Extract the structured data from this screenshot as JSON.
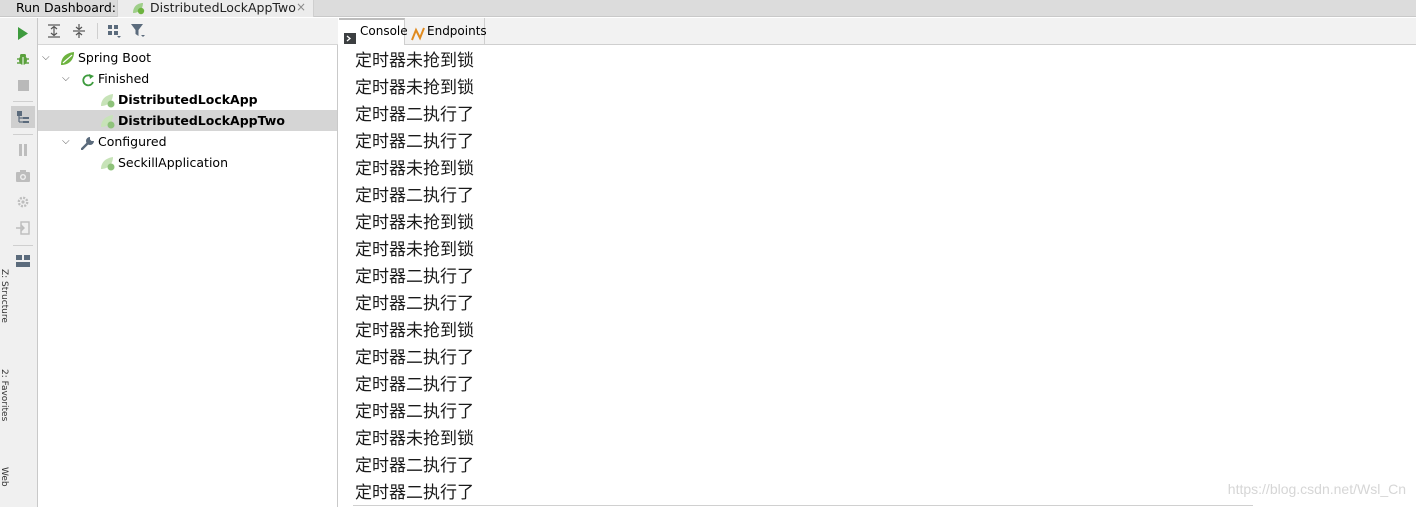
{
  "title_bar": {
    "label": "Run Dashboard:",
    "tab": {
      "name": "DistributedLockAppTwo",
      "close": "×"
    }
  },
  "toolbar": {
    "icons": [
      "run-icon",
      "debug-icon",
      "stop-icon",
      "group-by-icon",
      "pause-icon",
      "screenshot-icon",
      "settings-gear-icon",
      "sign-in-icon",
      "layout-icon"
    ]
  },
  "side_strip": {
    "structure": "Z: Structure",
    "favorites": "2: Favorites",
    "web": "Web"
  },
  "tree": {
    "root": "Spring Boot",
    "groups": [
      {
        "label": "Finished",
        "items": [
          "DistributedLockApp",
          "DistributedLockAppTwo"
        ]
      },
      {
        "label": "Configured",
        "items": [
          "SeckillApplication"
        ]
      }
    ]
  },
  "console": {
    "tabs": [
      "Console",
      "Endpoints"
    ],
    "lines": [
      "定时器未抢到锁",
      "定时器未抢到锁",
      "定时器二执行了",
      "定时器二执行了",
      "定时器未抢到锁",
      "定时器二执行了",
      "定时器未抢到锁",
      "定时器未抢到锁",
      "定时器二执行了",
      "定时器二执行了",
      "定时器未抢到锁",
      "定时器二执行了",
      "定时器二执行了",
      "定时器二执行了",
      "定时器未抢到锁",
      "定时器二执行了",
      "定时器二执行了"
    ],
    "watermark": "https://blog.csdn.net/Wsl_Cn"
  },
  "colors": {
    "run_green": "#3e9b3e",
    "spring_green": "#6db33f",
    "selection": "#d5d5d5",
    "toolbar_bg": "#f2f2f2"
  }
}
